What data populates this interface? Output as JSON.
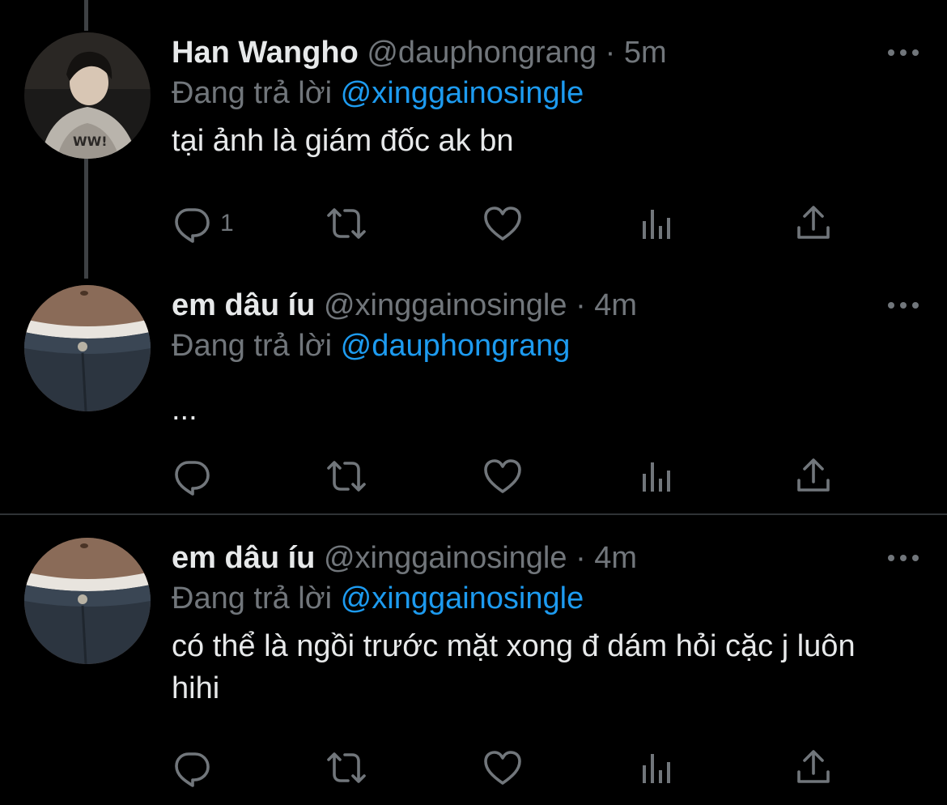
{
  "colors": {
    "background": "#000000",
    "text": "#e7e9ea",
    "muted": "#71767b",
    "accent": "#1d9bf0",
    "divider": "#2f3336"
  },
  "tweets": [
    {
      "display_name": "Han Wangho",
      "handle": "@dauphongrang",
      "time": "5m",
      "reply_prefix": "Đang trả lời",
      "reply_to": "@xinggainosingle",
      "text": "tại ảnh là giám đốc ak bn",
      "reply_count": "1",
      "avatar": "person-in-hoodie-photo"
    },
    {
      "display_name": "em dâu íu",
      "handle": "@xinggainosingle",
      "time": "4m",
      "reply_prefix": "Đang trả lời",
      "reply_to": "@dauphongrang",
      "text": "...",
      "reply_count": "",
      "avatar": "jeans-waist-photo"
    },
    {
      "display_name": "em dâu íu",
      "handle": "@xinggainosingle",
      "time": "4m",
      "reply_prefix": "Đang trả lời",
      "reply_to": "@xinggainosingle",
      "text": "có thể là ngồi trước mặt xong đ dám hỏi cặc j luôn hihi",
      "reply_count": "",
      "avatar": "jeans-waist-photo"
    }
  ],
  "separator_dot": "·",
  "icons": [
    "reply-icon",
    "retweet-icon",
    "like-icon",
    "analytics-icon",
    "share-icon",
    "more-icon"
  ]
}
